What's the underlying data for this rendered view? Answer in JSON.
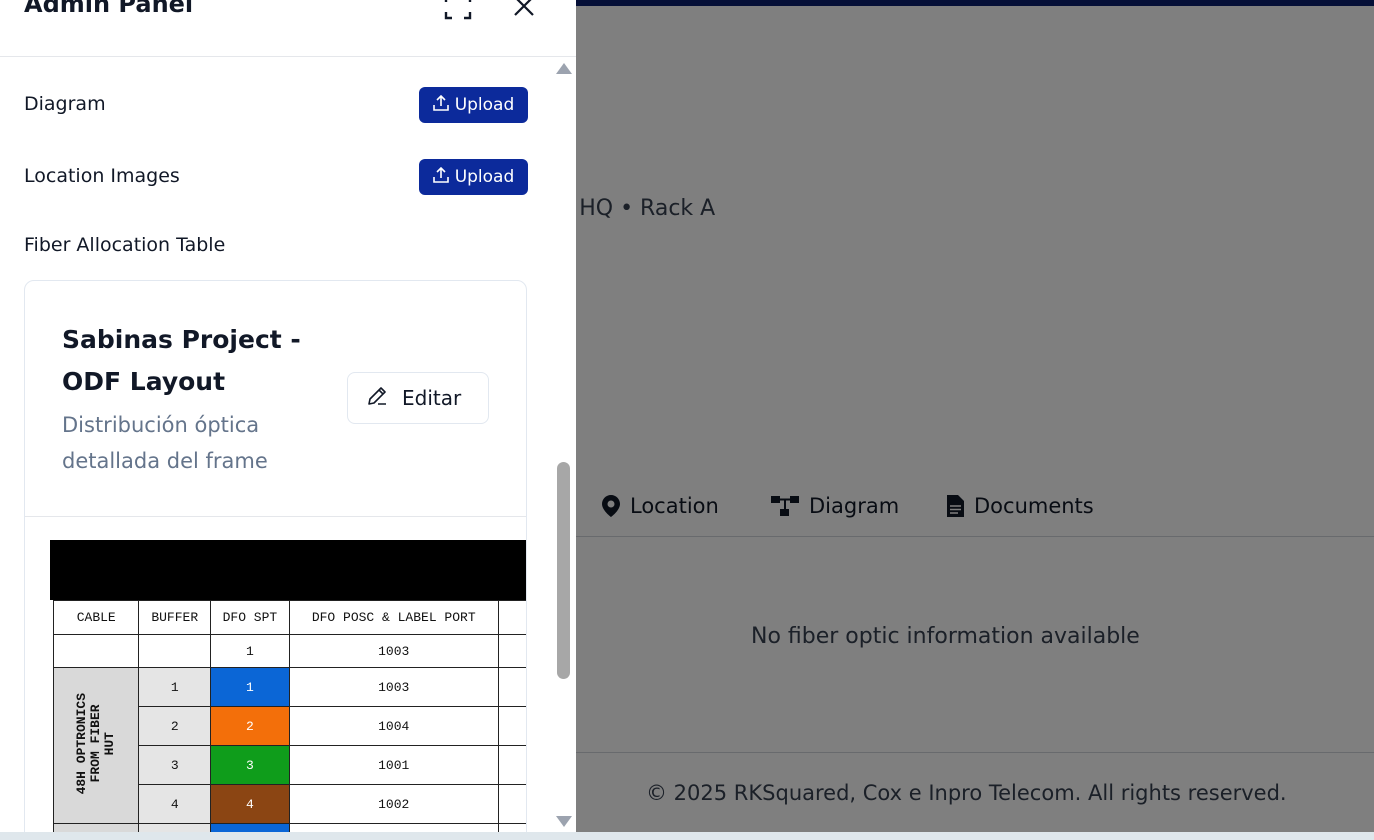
{
  "background": {
    "subtitle": "il HQ • Rack A",
    "tabs": [
      {
        "label": "Location",
        "icon": "map-pin-icon"
      },
      {
        "label": "Diagram",
        "icon": "diagram-icon"
      },
      {
        "label": "Documents",
        "icon": "document-icon"
      }
    ],
    "empty_message": "No fiber optic information available",
    "footer": "© 2025 RKSquared, Cox e Inpro Telecom. All rights reserved.",
    "colors": {
      "top_bar": "#0b1f6e",
      "overlay": "rgba(0,0,0,0.5)"
    }
  },
  "panel": {
    "title": "Admin Panel",
    "fullscreen_icon": "fullscreen-icon",
    "close_icon": "close-icon",
    "rows": [
      {
        "label": "Diagram",
        "button": "Upload"
      },
      {
        "label": "Location Images",
        "button": "Upload"
      }
    ],
    "section_title": "Fiber Allocation Table",
    "card": {
      "title": "Sabinas Project - ODF Layout",
      "description": "Distribución óptica detallada del frame",
      "edit_label": "Editar"
    },
    "accent_color": "#0c2a9b"
  },
  "fiber_table": {
    "headers": [
      "CABLE",
      "BUFFER",
      "DFO SPT",
      "DFO POSC & LABEL PORT"
    ],
    "first_row": {
      "spt": "1",
      "port": "1003"
    },
    "cable_label": "48H OPTRONICS\nFROM FIBER\nHUT",
    "rows": [
      {
        "buffer": "1",
        "spt": "1",
        "port": "1003",
        "color": "#0b66d6"
      },
      {
        "buffer": "2",
        "spt": "2",
        "port": "1004",
        "color": "#f36f0a"
      },
      {
        "buffer": "3",
        "spt": "3",
        "port": "1001",
        "color": "#0f9d1b"
      },
      {
        "buffer": "4",
        "spt": "4",
        "port": "1002",
        "color": "#8b4513"
      }
    ]
  }
}
